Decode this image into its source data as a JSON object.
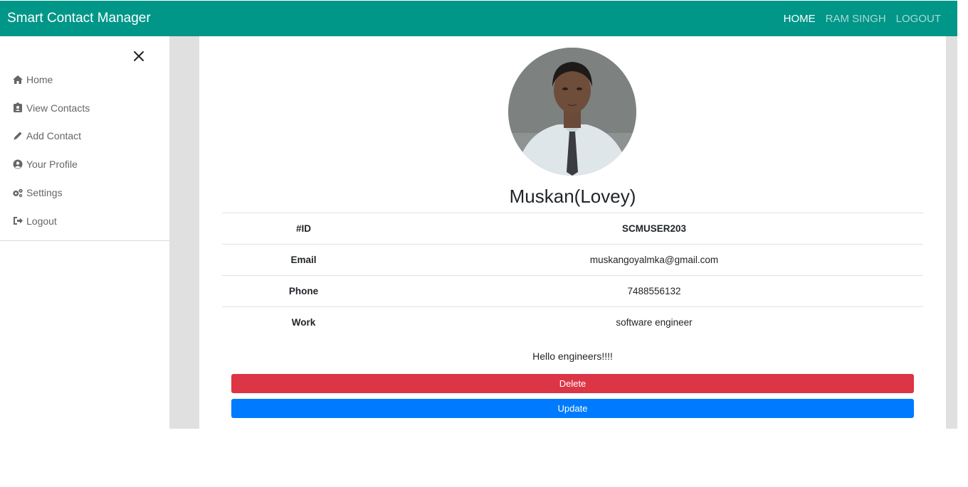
{
  "navbar": {
    "brand": "Smart Contact Manager",
    "links": [
      "HOME",
      "RAM SINGH",
      "LOGOUT"
    ],
    "bg_color": "#009688"
  },
  "sidebar": {
    "items": [
      {
        "label": "Home",
        "icon": "home-icon"
      },
      {
        "label": "View Contacts",
        "icon": "contact-card-icon"
      },
      {
        "label": "Add Contact",
        "icon": "pencil-icon"
      },
      {
        "label": "Your Profile",
        "icon": "user-circle-icon"
      },
      {
        "label": "Settings",
        "icon": "gears-icon"
      },
      {
        "label": "Logout",
        "icon": "sign-out-icon"
      }
    ]
  },
  "contact": {
    "name": "Muskan(Lovey)",
    "rows": [
      {
        "key": "#ID",
        "value": "SCMUSER203"
      },
      {
        "key": "Email",
        "value": "muskangoyalmka@gmail.com"
      },
      {
        "key": "Phone",
        "value": "7488556132"
      },
      {
        "key": "Work",
        "value": "software engineer"
      }
    ],
    "about": "Hello engineers!!!!"
  },
  "buttons": {
    "delete": "Delete",
    "update": "Update",
    "delete_color": "#dc3545",
    "update_color": "#007bff"
  }
}
